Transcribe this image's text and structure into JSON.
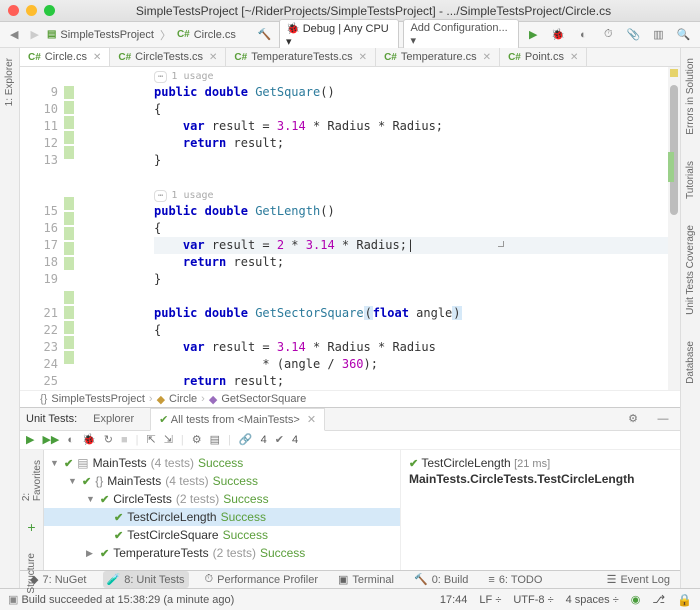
{
  "window": {
    "title": "SimpleTestsProject [~/RiderProjects/SimpleTestsProject] - .../SimpleTestsProject/Circle.cs"
  },
  "nav": {
    "project": "SimpleTestsProject",
    "file": "Circle.cs",
    "run_config": "Debug | Any CPU",
    "add_config": "Add Configuration..."
  },
  "tabs": [
    {
      "label": "Circle.cs",
      "active": true
    },
    {
      "label": "CircleTests.cs"
    },
    {
      "label": "TemperatureTests.cs"
    },
    {
      "label": "Temperature.cs"
    },
    {
      "label": "Point.cs"
    }
  ],
  "code": {
    "usage1": "1 usage",
    "usage2": "1 usage",
    "lines": {
      "l9": "public double GetSquare()",
      "l10": "{",
      "l11": "    var result = 3.14 * Radius * Radius;",
      "l12": "    return result;",
      "l13": "}",
      "l15": "public double GetLength()",
      "l16": "{",
      "l17": "    var result = 2 * 3.14 * Radius;",
      "l18": "    return result;",
      "l19": "}",
      "l21": "public double GetSectorSquare(float angle)",
      "l22": "{",
      "l23": "    var result = 3.14 * Radius * Radius",
      "l24": "               * (angle / 360);",
      "l25": "    return result;"
    }
  },
  "breadcrumb": {
    "a": "SimpleTestsProject",
    "b": "Circle",
    "c": "GetSectorSquare"
  },
  "tests_panel": {
    "title": "Unit Tests:",
    "tab_explorer": "Explorer",
    "tab_session": "All tests from <MainTests>",
    "pass_count": "4",
    "fail_count": "4"
  },
  "tree": {
    "root": "MainTests",
    "root_count": "(4 tests)",
    "success": "Success",
    "n1": "MainTests",
    "n1_count": "(4 tests)",
    "n2": "CircleTests",
    "n2_count": "(2 tests)",
    "t1": "TestCircleLength",
    "t2": "TestCircleSquare",
    "n3": "TemperatureTests",
    "n3_count": "(2 tests)"
  },
  "detail": {
    "name": "TestCircleLength",
    "time": "[21 ms]",
    "path": "MainTests.CircleTests.TestCircleLength"
  },
  "bottom": {
    "nuget": "7: NuGet",
    "ut": "8: Unit Tests",
    "perf": "Performance Profiler",
    "term": "Terminal",
    "build": "0: Build",
    "todo": "6: TODO",
    "log": "Event Log"
  },
  "status": {
    "msg": "Build succeeded at 15:38:29 (a minute ago)",
    "pos": "17:44",
    "le": "LF",
    "enc": "UTF-8",
    "indent": "4 spaces"
  },
  "side": {
    "explorer": "1: Explorer",
    "favorites": "2: Favorites",
    "structure": "Structure",
    "errors": "Errors in Solution",
    "tutorials": "Tutorials",
    "coverage": "Unit Tests Coverage",
    "database": "Database"
  }
}
